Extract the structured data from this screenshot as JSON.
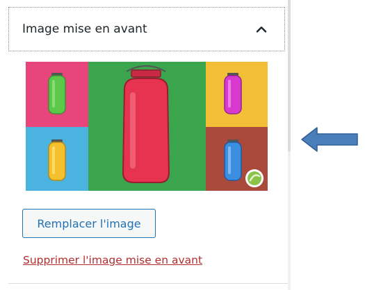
{
  "panel": {
    "title": "Image mise en avant",
    "toggle_icon": "chevron-up-icon"
  },
  "featured_image": {
    "description_icon": "jars-collage-image",
    "colors": {
      "pink": "#e8457d",
      "green": "#3aa54c",
      "blue": "#4bb3e0",
      "yellow": "#f2bf36",
      "red_brown": "#a94a3c",
      "jar_red": "#e63350"
    }
  },
  "actions": {
    "replace_label": "Remplacer l'image",
    "remove_label": "Supprimer l'image mise en avant"
  },
  "colors": {
    "accent": "#2271b1",
    "danger": "#b32d2e",
    "pointer_arrow": "#4a7ebb"
  }
}
